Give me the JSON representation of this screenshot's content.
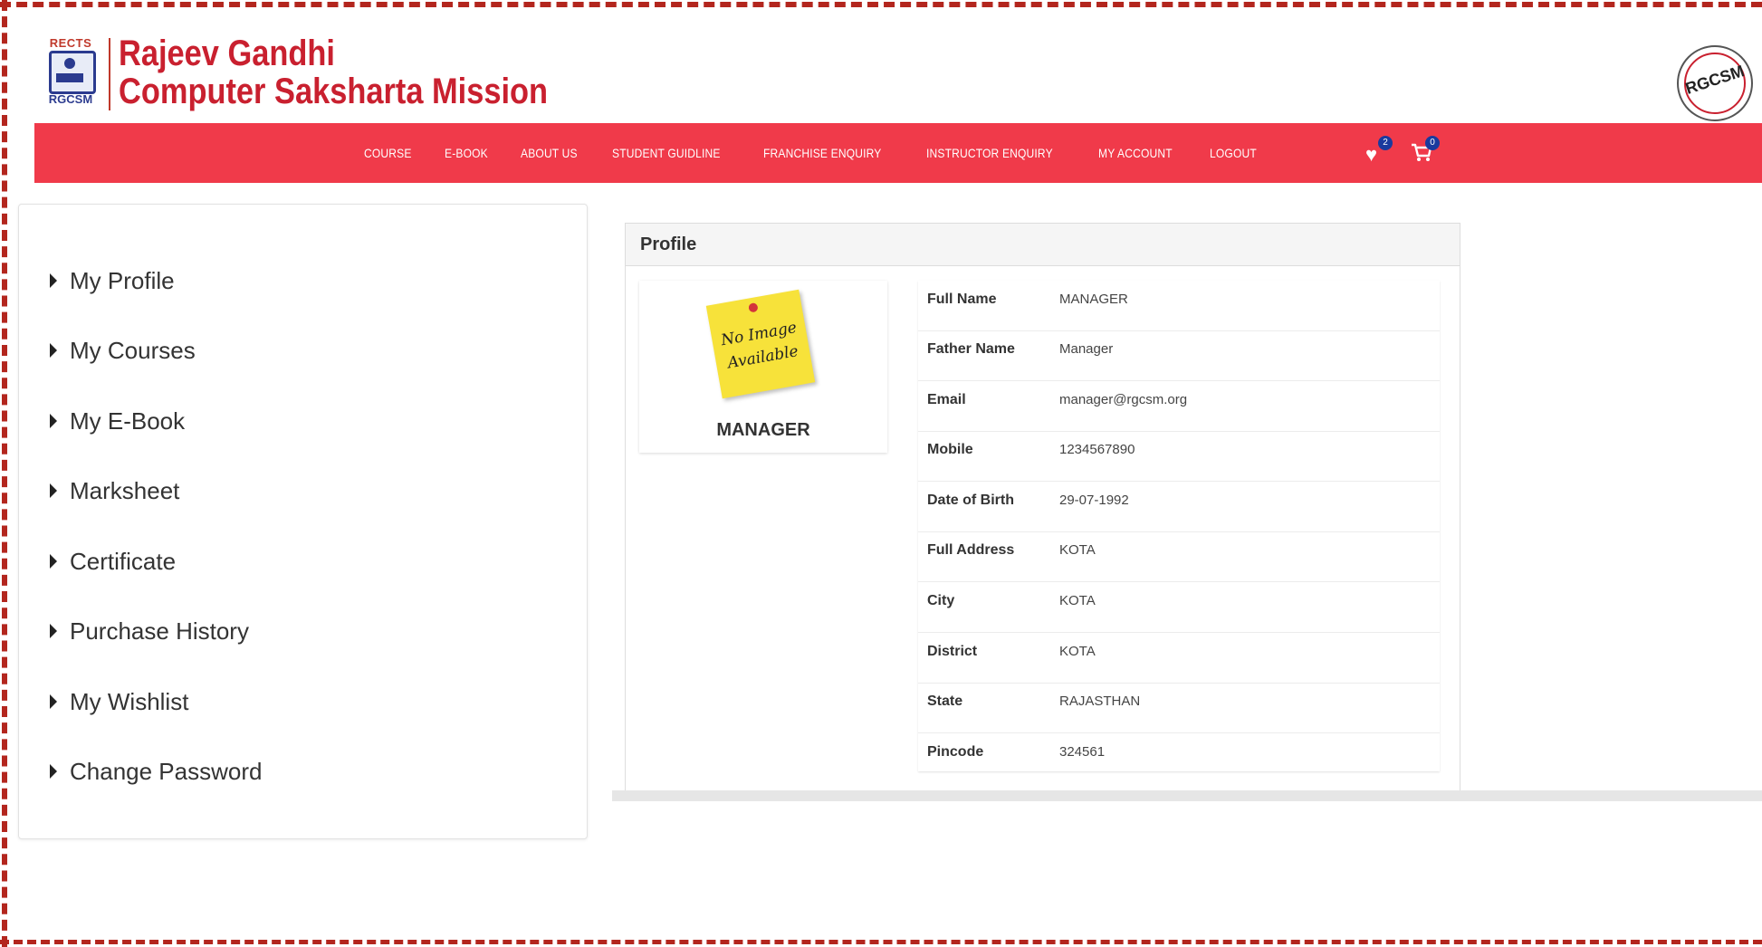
{
  "header": {
    "logo_top": "RECTS",
    "logo_bottom": "RGCSM",
    "brand_line1": "Rajeev Gandhi",
    "brand_line2": "Computer Saksharta Mission",
    "seal_text": "RGCSM"
  },
  "nav": {
    "items": [
      "COURSE",
      "E-BOOK",
      "ABOUT US",
      "STUDENT GUIDLINE",
      "FRANCHISE ENQUIRY",
      "INSTRUCTOR ENQUIRY",
      "MY ACCOUNT",
      "LOGOUT"
    ],
    "wishlist_count": "2",
    "cart_count": "0",
    "icons": [
      "heart-icon",
      "cart-icon"
    ]
  },
  "sidebar": {
    "items": [
      "My Profile",
      "My Courses",
      "My E-Book",
      "Marksheet",
      "Certificate",
      "Purchase History",
      "My Wishlist",
      "Change Password"
    ]
  },
  "profile": {
    "title": "Profile",
    "photo_note": "No Image Available",
    "name": "MANAGER",
    "fields": [
      {
        "label": "Full Name",
        "value": "MANAGER"
      },
      {
        "label": "Father Name",
        "value": "Manager"
      },
      {
        "label": "Email",
        "value": "manager@rgcsm.org"
      },
      {
        "label": "Mobile",
        "value": "1234567890"
      },
      {
        "label": "Date of Birth",
        "value": "29-07-1992"
      },
      {
        "label": "Full Address",
        "value": "KOTA"
      },
      {
        "label": "City",
        "value": "KOTA"
      },
      {
        "label": "District",
        "value": "KOTA"
      },
      {
        "label": "State",
        "value": "RAJASTHAN"
      },
      {
        "label": "Pincode",
        "value": "324561"
      }
    ]
  },
  "colors": {
    "brand_red": "#c9202f",
    "nav_bg": "#f03a4a",
    "badge_blue": "#1a3a9e",
    "frame": "#b3261e"
  }
}
